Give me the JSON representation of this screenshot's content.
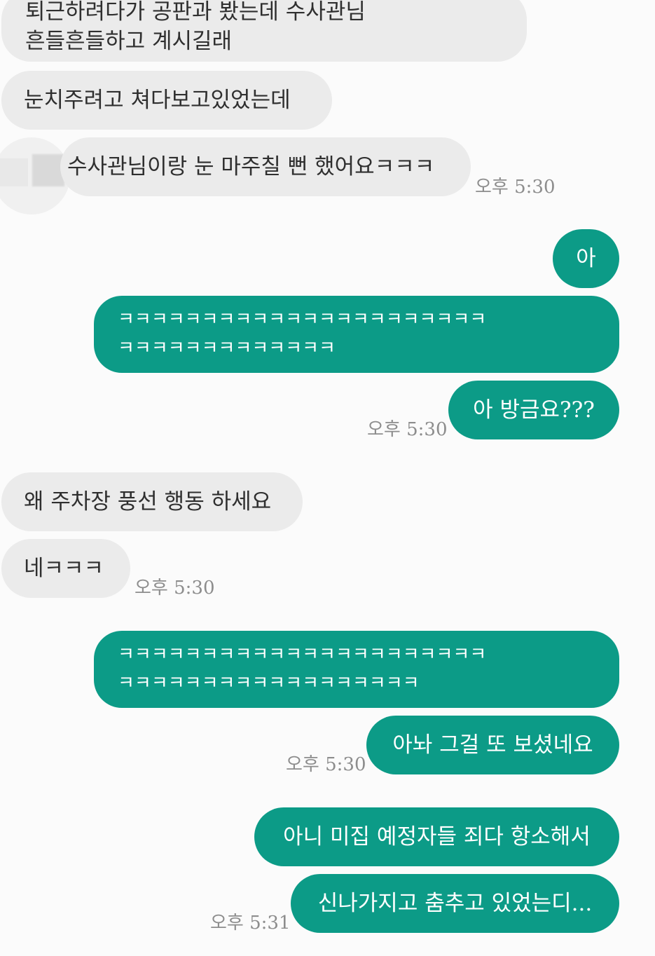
{
  "messages": {
    "m1": {
      "line1": "퇴근하려다가 공판과 봤는데 수사관님",
      "line2": "흔들흔들하고 계시길래"
    },
    "m2": "눈치주려고 쳐다보고있었는데",
    "m3": "수사관님이랑 눈 마주칠 뻔 했어요ㅋㅋㅋ",
    "t1": "오후 5:30",
    "m4": "아",
    "m5": {
      "line1": "ㅋㅋㅋㅋㅋㅋㅋㅋㅋㅋㅋㅋㅋㅋㅋㅋㅋㅋㅋㅋㅋㅋ",
      "line2": "ㅋㅋㅋㅋㅋㅋㅋㅋㅋㅋㅋㅋㅋ"
    },
    "m6": "아 방금요???",
    "t2": "오후 5:30",
    "m7": "왜 주차장 풍선 행동 하세요",
    "m8": "네ㅋㅋㅋ",
    "t3": "오후 5:30",
    "m9": {
      "line1": "ㅋㅋㅋㅋㅋㅋㅋㅋㅋㅋㅋㅋㅋㅋㅋㅋㅋㅋㅋㅋㅋㅋ",
      "line2": "ㅋㅋㅋㅋㅋㅋㅋㅋㅋㅋㅋㅋㅋㅋㅋㅋㅋㅋ"
    },
    "m10": "아놔 그걸 또 보셨네요",
    "t4": "오후 5:30",
    "m11": "아니 미집 예정자들 죄다 항소해서",
    "m12": "신나가지고 춤추고 있었는디...",
    "t5": "오후 5:31"
  },
  "colors": {
    "incoming_bubble": "#ebebeb",
    "outgoing_bubble": "#0c9b87",
    "timestamp": "#8d8d8d",
    "background": "#fbfbfb"
  }
}
